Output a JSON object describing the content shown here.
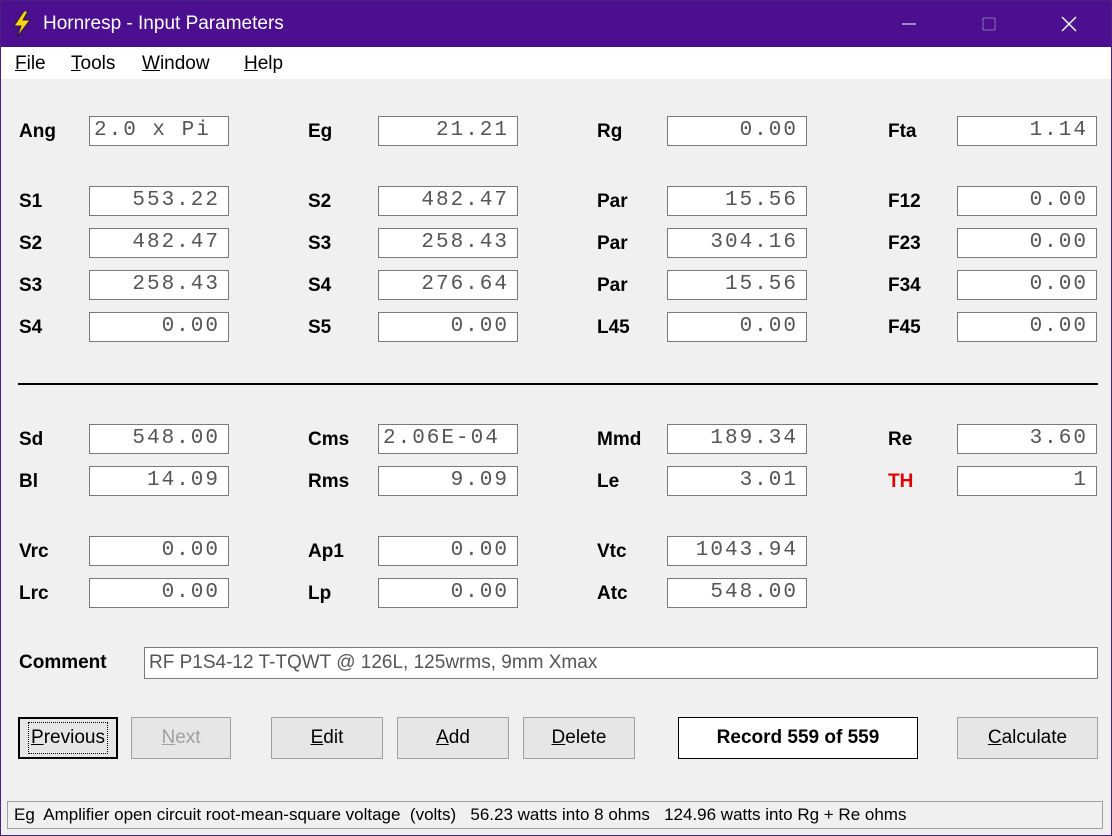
{
  "window": {
    "title": "Hornresp - Input Parameters",
    "titlebar_color": "#4b0f8f"
  },
  "menu": [
    {
      "label": "File",
      "mnemonic": "F",
      "rest": "ile"
    },
    {
      "label": "Tools",
      "mnemonic": "T",
      "rest": "ools"
    },
    {
      "label": "Window",
      "mnemonic": "W",
      "rest": "indow"
    },
    {
      "label": "Help",
      "mnemonic": "H",
      "rest": "elp"
    }
  ],
  "params": {
    "ang": {
      "label": "Ang",
      "value": "2.0 x Pi"
    },
    "eg": {
      "label": "Eg",
      "value": "21.21"
    },
    "rg": {
      "label": "Rg",
      "value": "0.00"
    },
    "fta": {
      "label": "Fta",
      "value": "1.14"
    },
    "s1a": {
      "label": "S1",
      "value": "553.22"
    },
    "s2b": {
      "label": "S2",
      "value": "482.47"
    },
    "par1": {
      "label": "Par",
      "value": "15.56"
    },
    "f12": {
      "label": "F12",
      "value": "0.00"
    },
    "s2a": {
      "label": "S2",
      "value": "482.47"
    },
    "s3b": {
      "label": "S3",
      "value": "258.43"
    },
    "par2": {
      "label": "Par",
      "value": "304.16"
    },
    "f23": {
      "label": "F23",
      "value": "0.00"
    },
    "s3a": {
      "label": "S3",
      "value": "258.43"
    },
    "s4b": {
      "label": "S4",
      "value": "276.64"
    },
    "par3": {
      "label": "Par",
      "value": "15.56"
    },
    "f34": {
      "label": "F34",
      "value": "0.00"
    },
    "s4a": {
      "label": "S4",
      "value": "0.00"
    },
    "s5": {
      "label": "S5",
      "value": "0.00"
    },
    "l45": {
      "label": "L45",
      "value": "0.00"
    },
    "f45": {
      "label": "F45",
      "value": "0.00"
    },
    "sd": {
      "label": "Sd",
      "value": "548.00"
    },
    "cms": {
      "label": "Cms",
      "value": "2.06E-04"
    },
    "mmd": {
      "label": "Mmd",
      "value": "189.34"
    },
    "re": {
      "label": "Re",
      "value": "3.60"
    },
    "bl": {
      "label": "Bl",
      "value": "14.09"
    },
    "rms": {
      "label": "Rms",
      "value": "9.09"
    },
    "le": {
      "label": "Le",
      "value": "3.01"
    },
    "th": {
      "label": "TH",
      "value": "1",
      "color": "#e00000"
    },
    "vrc": {
      "label": "Vrc",
      "value": "0.00"
    },
    "ap1": {
      "label": "Ap1",
      "value": "0.00"
    },
    "vtc": {
      "label": "Vtc",
      "value": "1043.94"
    },
    "lrc": {
      "label": "Lrc",
      "value": "0.00"
    },
    "lp": {
      "label": "Lp",
      "value": "0.00"
    },
    "atc": {
      "label": "Atc",
      "value": "548.00"
    }
  },
  "comment": {
    "label": "Comment",
    "value": "RF P1S4-12 T-TQWT @ 126L, 125wrms, 9mm Xmax"
  },
  "buttons": {
    "previous": {
      "label": "Previous",
      "mnemonic": "P",
      "rest": "revious"
    },
    "next": {
      "label": "Next",
      "mnemonic": "N",
      "rest": "ext"
    },
    "edit": {
      "label": "Edit",
      "mnemonic": "E",
      "rest": "dit"
    },
    "add": {
      "label": "Add",
      "mnemonic": "A",
      "rest": "dd"
    },
    "delete": {
      "label": "Delete",
      "mnemonic": "D",
      "rest": "elete"
    },
    "record": "Record 559 of 559",
    "calculate": {
      "label": "Calculate",
      "mnemonic": "C",
      "rest": "alculate"
    }
  },
  "status": "Eg  Amplifier open circuit root-mean-square voltage  (volts)   56.23 watts into 8 ohms   124.96 watts into Rg + Re ohms"
}
